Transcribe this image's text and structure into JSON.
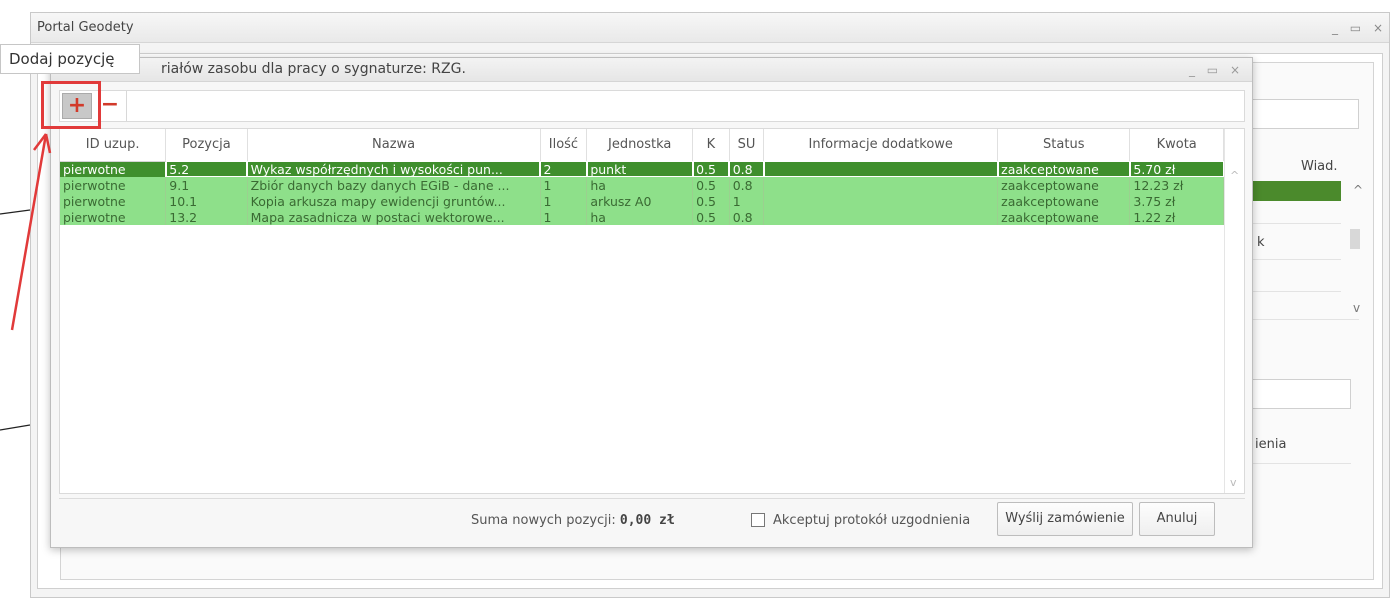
{
  "outer_window": {
    "title": "Portal Geodety",
    "ctrl_minimize": "_",
    "ctrl_maximize": "▭",
    "ctrl_close": "×"
  },
  "background": {
    "col_wiad": "Wiad.",
    "col_ienia": "ienia",
    "cell_k": "k",
    "scroll_up": "^",
    "scroll_down": "v"
  },
  "tooltip": {
    "text": "Dodaj pozycję"
  },
  "dialog": {
    "title": "riałów zasobu dla pracy o sygnaturze: RZG.",
    "ctrl_minimize": "_",
    "ctrl_maximize": "▭",
    "ctrl_close": "×",
    "toolbar": {
      "add_label": "+",
      "remove_label": "−"
    },
    "grid": {
      "columns": [
        "ID uzup.",
        "Pozycja",
        "Nazwa",
        "Ilość",
        "Jednostka",
        "K",
        "SU",
        "Informacje dodatkowe",
        "Status",
        "Kwota"
      ],
      "rows": [
        [
          "pierwotne",
          "5.2",
          "Wykaz współrzędnych i wysokości pun...",
          "2",
          "punkt",
          "0.5",
          "0.8",
          "",
          "zaakceptowane",
          "5.70 zł"
        ],
        [
          "pierwotne",
          "9.1",
          "Zbiór danych bazy danych EGiB - dane ...",
          "1",
          "ha",
          "0.5",
          "0.8",
          "",
          "zaakceptowane",
          "12.23 zł"
        ],
        [
          "pierwotne",
          "10.1",
          "Kopia arkusza mapy ewidencji gruntów...",
          "1",
          "arkusz A0",
          "0.5",
          "1",
          "",
          "zaakceptowane",
          "3.75 zł"
        ],
        [
          "pierwotne",
          "13.2",
          "Mapa zasadnicza w postaci wektorowe...",
          "1",
          "ha",
          "0.5",
          "0.8",
          "",
          "zaakceptowane",
          "1.22 zł"
        ]
      ],
      "scroll_up": "^",
      "scroll_down": "v"
    },
    "footer": {
      "sum_label": "Suma nowych pozycji:",
      "sum_value": "0,00 zł",
      "accept_label": "Akceptuj protokół uzgodnienia",
      "send_button": "Wyślij zamówienie",
      "cancel_button": "Anuluj"
    }
  },
  "colors": {
    "selected_row": "#3f8f2d",
    "row": "#8ee08a",
    "highlight": "#e13a3a"
  }
}
